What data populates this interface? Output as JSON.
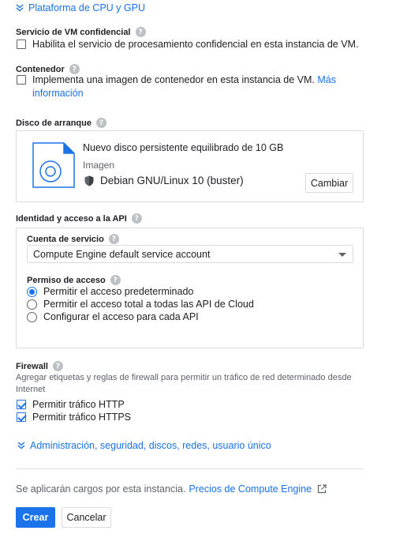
{
  "cpu_gpu": {
    "label": "Plataforma de CPU y GPU"
  },
  "confidential": {
    "title": "Servicio de VM confidencial",
    "checkbox_label": "Habilita el servicio de procesamiento confidencial en esta instancia de VM."
  },
  "container": {
    "title": "Contenedor",
    "checkbox_label": "Implementa una imagen de contenedor en esta instancia de VM.",
    "link_part1": "Más",
    "link_part2": "información"
  },
  "boot_disk": {
    "title": "Disco de arranque",
    "description": "Nuevo disco persistente equilibrado de 10 GB",
    "image_label": "Imagen",
    "os": "Debian GNU/Linux 10 (buster)",
    "change_button": "Cambiar"
  },
  "identity": {
    "title": "Identidad y acceso a la API",
    "service_account_label": "Cuenta de servicio",
    "service_account_value": "Compute Engine default service account",
    "access_label": "Permiso de acceso",
    "access_options": [
      {
        "label": "Permitir el acceso predeterminado",
        "selected": true
      },
      {
        "label": "Permitir el acceso total a todas las API de Cloud",
        "selected": false
      },
      {
        "label": "Configurar el acceso para cada API",
        "selected": false
      }
    ]
  },
  "firewall": {
    "title": "Firewall",
    "description": "Agregar etiquetas y reglas de firewall para permitir un tráfico de red determinado desde Internet",
    "http_label": "Permitir tráfico HTTP",
    "https_label": "Permitir tráfico HTTPS",
    "http_checked": true,
    "https_checked": true
  },
  "advanced": {
    "label": "Administración, seguridad, discos, redes, usuario único"
  },
  "footer": {
    "charges_text": "Se aplicarán cargos por esta instancia.",
    "pricing_link": "Precios de Compute Engine",
    "create_button": "Crear",
    "cancel_button": "Cancelar"
  },
  "colors": {
    "accent": "#1a73e8",
    "border": "#dadce0",
    "help_icon": "#bdc1c6"
  }
}
